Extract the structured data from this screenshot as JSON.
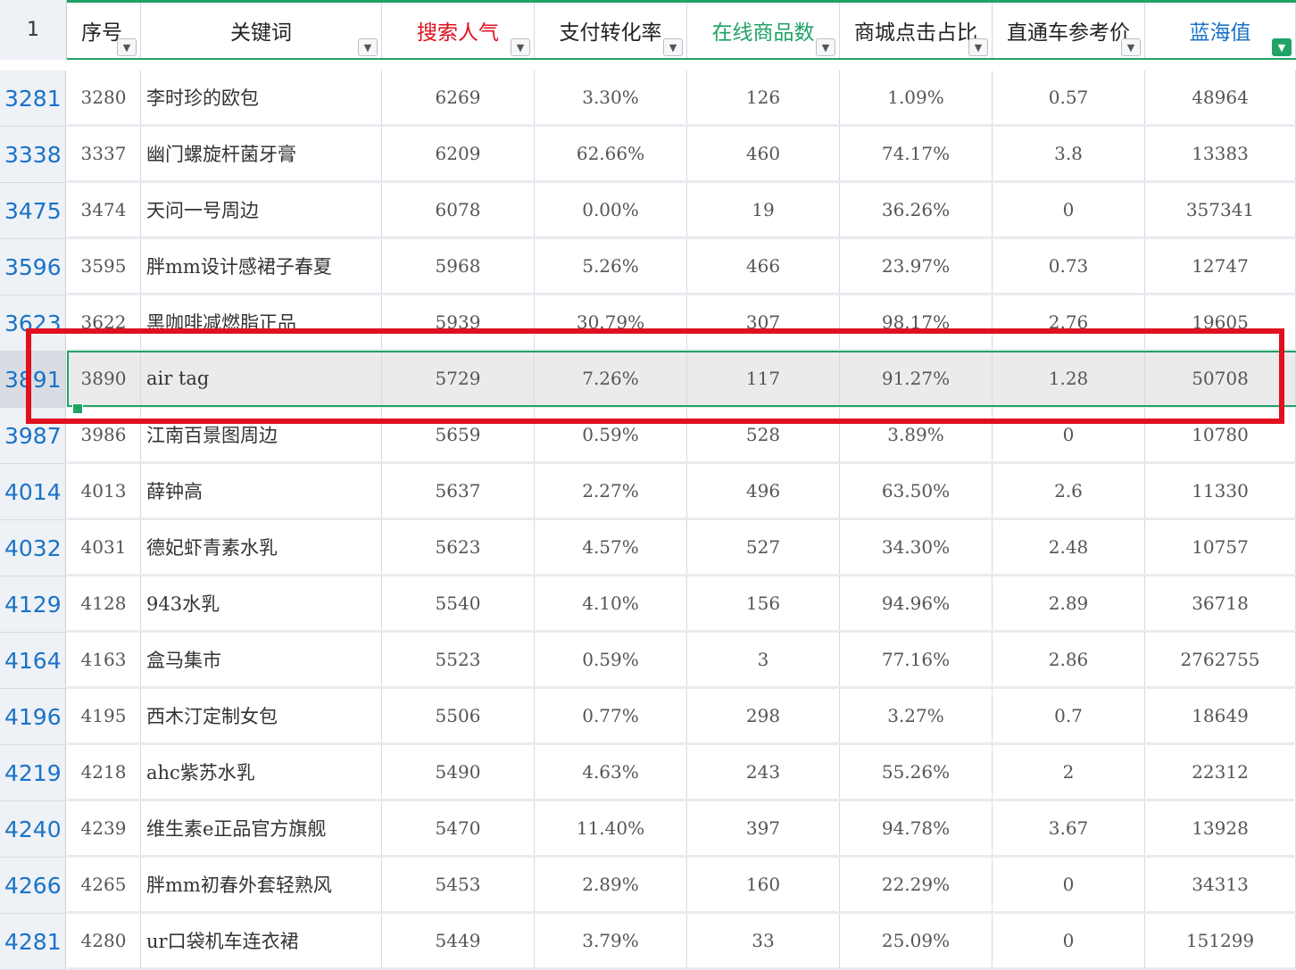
{
  "corner_row_number": "1",
  "columns": [
    {
      "key": "seq",
      "label": "序号",
      "color": "#222222"
    },
    {
      "key": "keyword",
      "label": "关键词",
      "color": "#222222"
    },
    {
      "key": "search_pop",
      "label": "搜索人气",
      "color": "#e0101f"
    },
    {
      "key": "pay_conv",
      "label": "支付转化率",
      "color": "#222222"
    },
    {
      "key": "online_items",
      "label": "在线商品数",
      "color": "#21a366"
    },
    {
      "key": "mall_click",
      "label": "商城点击占比",
      "color": "#222222"
    },
    {
      "key": "ztc_price",
      "label": "直通车参考价",
      "color": "#222222"
    },
    {
      "key": "blue_ocean",
      "label": "蓝海值",
      "color": "#1a73c8"
    }
  ],
  "filter_icon": "dropdown-triangle-icon",
  "active_filter_icon": "funnel-icon",
  "selected_row_index": 5,
  "rows": [
    {
      "row_num": "3281",
      "cells": [
        "3280",
        "李时珍的欧包",
        "6269",
        "3.30%",
        "126",
        "1.09%",
        "0.57",
        "48964"
      ]
    },
    {
      "row_num": "3338",
      "cells": [
        "3337",
        "幽门螺旋杆菌牙膏",
        "6209",
        "62.66%",
        "460",
        "74.17%",
        "3.8",
        "13383"
      ]
    },
    {
      "row_num": "3475",
      "cells": [
        "3474",
        "天问一号周边",
        "6078",
        "0.00%",
        "19",
        "36.26%",
        "0",
        "357341"
      ]
    },
    {
      "row_num": "3596",
      "cells": [
        "3595",
        "胖mm设计感裙子春夏",
        "5968",
        "5.26%",
        "466",
        "23.97%",
        "0.73",
        "12747"
      ]
    },
    {
      "row_num": "3623",
      "cells": [
        "3622",
        "黑咖啡减燃脂正品",
        "5939",
        "30.79%",
        "307",
        "98.17%",
        "2.76",
        "19605"
      ]
    },
    {
      "row_num": "3891",
      "cells": [
        "3890",
        "air tag",
        "5729",
        "7.26%",
        "117",
        "91.27%",
        "1.28",
        "50708"
      ]
    },
    {
      "row_num": "3987",
      "cells": [
        "3986",
        "江南百景图周边",
        "5659",
        "0.59%",
        "528",
        "3.89%",
        "0",
        "10780"
      ]
    },
    {
      "row_num": "4014",
      "cells": [
        "4013",
        "薛钟高",
        "5637",
        "2.27%",
        "496",
        "63.50%",
        "2.6",
        "11330"
      ]
    },
    {
      "row_num": "4032",
      "cells": [
        "4031",
        "德妃虾青素水乳",
        "5623",
        "4.57%",
        "527",
        "34.30%",
        "2.48",
        "10757"
      ]
    },
    {
      "row_num": "4129",
      "cells": [
        "4128",
        "943水乳",
        "5540",
        "4.10%",
        "156",
        "94.96%",
        "2.89",
        "36718"
      ]
    },
    {
      "row_num": "4164",
      "cells": [
        "4163",
        "盒马集市",
        "5523",
        "0.59%",
        "3",
        "77.16%",
        "2.86",
        "2762755"
      ]
    },
    {
      "row_num": "4196",
      "cells": [
        "4195",
        "西木汀定制女包",
        "5506",
        "0.77%",
        "298",
        "3.27%",
        "0.7",
        "18649"
      ]
    },
    {
      "row_num": "4219",
      "cells": [
        "4218",
        "ahc紫苏水乳",
        "5490",
        "4.63%",
        "243",
        "55.26%",
        "2",
        "22312"
      ]
    },
    {
      "row_num": "4240",
      "cells": [
        "4239",
        "维生素e正品官方旗舰",
        "5470",
        "11.40%",
        "397",
        "94.78%",
        "3.67",
        "13928"
      ]
    },
    {
      "row_num": "4266",
      "cells": [
        "4265",
        "胖mm初春外套轻熟风",
        "5453",
        "2.89%",
        "160",
        "22.29%",
        "0",
        "34313"
      ]
    },
    {
      "row_num": "4281",
      "cells": [
        "4280",
        "ur口袋机车连衣裙",
        "5449",
        "3.79%",
        "33",
        "25.09%",
        "0",
        "151299"
      ]
    }
  ],
  "highlight_color": "#e0101f",
  "selection_color": "#21a366"
}
